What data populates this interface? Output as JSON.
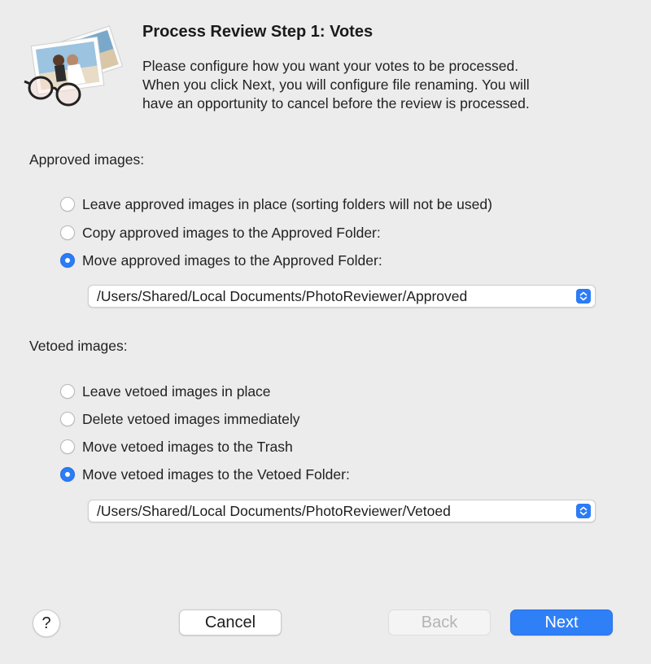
{
  "dialog": {
    "title": "Process Review Step 1: Votes",
    "intro_lines": [
      "Please configure how you want your votes to be processed.",
      "When you click Next, you will configure file renaming.  You will",
      "have an opportunity to cancel before the review is processed."
    ],
    "icon": "photos-and-glasses-icon"
  },
  "approved": {
    "label": "Approved images:",
    "options": [
      {
        "label": "Leave approved images in place (sorting folders will not be used)",
        "selected": false
      },
      {
        "label": "Copy approved images to the Approved Folder:",
        "selected": false
      },
      {
        "label": "Move approved images to the Approved Folder:",
        "selected": true
      }
    ],
    "folder_path": "/Users/Shared/Local Documents/PhotoReviewer/Approved"
  },
  "vetoed": {
    "label": "Vetoed images:",
    "options": [
      {
        "label": "Leave vetoed images in place",
        "selected": false
      },
      {
        "label": "Delete vetoed images immediately",
        "selected": false
      },
      {
        "label": "Move vetoed images to the Trash",
        "selected": false
      },
      {
        "label": "Move vetoed images to the Vetoed Folder:",
        "selected": true
      }
    ],
    "folder_path": "/Users/Shared/Local Documents/PhotoReviewer/Vetoed"
  },
  "buttons": {
    "help": "?",
    "cancel": "Cancel",
    "back": "Back",
    "next": "Next"
  },
  "colors": {
    "accent": "#2b7cf6",
    "background": "#ececec"
  }
}
